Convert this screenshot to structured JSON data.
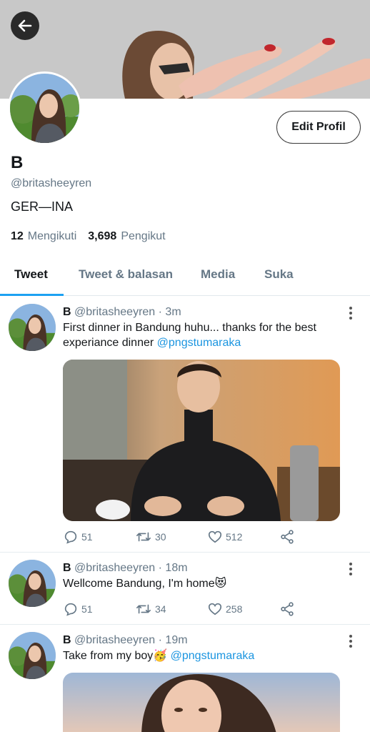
{
  "profile": {
    "display_name": "B",
    "handle": "@britasheeyren",
    "bio": "GER—INA",
    "following_count": "12",
    "following_label": "Mengikuti",
    "followers_count": "3,698",
    "followers_label": "Pengikut",
    "edit_button": "Edit Profil"
  },
  "tabs": [
    {
      "label": "Tweet",
      "active": true
    },
    {
      "label": "Tweet & balasan",
      "active": false
    },
    {
      "label": "Media",
      "active": false
    },
    {
      "label": "Suka",
      "active": false
    }
  ],
  "tweets": [
    {
      "name": "B",
      "handle": "@britasheeyren",
      "time": "· 3m",
      "text": "First dinner in Bandung huhu... thanks for the best experiance dinner",
      "mention": "@pngstumaraka",
      "replies": "51",
      "retweets": "30",
      "likes": "512"
    },
    {
      "name": "B",
      "handle": "@britasheeyren",
      "time": "· 18m",
      "text": "Wellcome Bandung, I'm home",
      "emoji": "😻",
      "replies": "51",
      "retweets": "34",
      "likes": "258"
    },
    {
      "name": "B",
      "handle": "@britasheeyren",
      "time": "· 19m",
      "text": "Take from my boy",
      "emoji": "🥳",
      "mention": "@pngstumaraka"
    }
  ],
  "colors": {
    "accent": "#1da1f2",
    "mention": "#1b95e0",
    "muted": "#657786"
  }
}
